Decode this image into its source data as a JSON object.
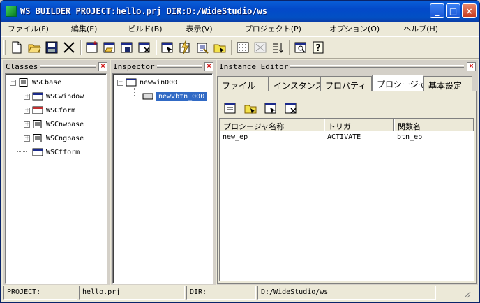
{
  "window": {
    "title": "WS BUILDER PROJECT:hello.prj DIR:D:/WideStudio/ws",
    "minimize_glyph": "_",
    "maximize_glyph": "□",
    "close_glyph": "×"
  },
  "menubar": {
    "items": [
      {
        "label": "ファイル(F)"
      },
      {
        "label": "編集(E)"
      },
      {
        "label": "ビルド(B)"
      },
      {
        "label": "表示(V)"
      },
      {
        "label": "プロジェクト(P)"
      },
      {
        "label": "オプション(O)"
      },
      {
        "label": "ヘルプ(H)"
      }
    ]
  },
  "toolbar": {
    "tools": [
      "new-file-icon",
      "open-folder-icon",
      "save-icon",
      "cut-icon",
      "new-window-icon",
      "open-window-icon",
      "save-window-icon",
      "delete-window-icon",
      "select-window-icon",
      "build-icon",
      "compile-icon",
      "folder-icon",
      "grid-icon",
      "align-icon",
      "sort-icon",
      "preview-icon",
      "help-icon"
    ]
  },
  "classes_panel": {
    "title": "Classes",
    "close_glyph": "×",
    "tree": [
      {
        "label": "WSCbase",
        "expander": "−"
      },
      {
        "label": "WSCwindow",
        "expander": "+"
      },
      {
        "label": "WSCform",
        "expander": "+"
      },
      {
        "label": "WSCnwbase",
        "expander": "+"
      },
      {
        "label": "WSCngbase",
        "expander": "+"
      },
      {
        "label": "WSCfform",
        "expander": ""
      }
    ]
  },
  "inspector_panel": {
    "title": "Inspector",
    "close_glyph": "×",
    "tree": [
      {
        "label": "newwin000",
        "expander": "−"
      },
      {
        "label": "newvbtn_000",
        "expander": "",
        "selected": true
      }
    ]
  },
  "instance_editor": {
    "title": "Instance Editor",
    "close_glyph": "×",
    "tabs": [
      {
        "label": "ファイル"
      },
      {
        "label": "インスタンス"
      },
      {
        "label": "プロパティ"
      },
      {
        "label": "プロシージャ",
        "active": true
      },
      {
        "label": "基本設定"
      }
    ],
    "proc_tools": [
      "new-procedure-icon",
      "open-procedure-icon",
      "edit-procedure-icon",
      "delete-procedure-icon"
    ],
    "columns": [
      "プロシージャ名称",
      "トリガ",
      "関数名"
    ],
    "rows": [
      {
        "name": "new_ep",
        "trigger": "ACTIVATE",
        "function": "btn_ep"
      }
    ]
  },
  "statusbar": {
    "project_label": "PROJECT:",
    "project_value": "hello.prj",
    "dir_label": "DIR:",
    "dir_value": "D:/WideStudio/ws"
  },
  "colors": {
    "titlebar": "#0349c9",
    "selection": "#316ac5",
    "panel_bg": "#d4d0c8"
  }
}
